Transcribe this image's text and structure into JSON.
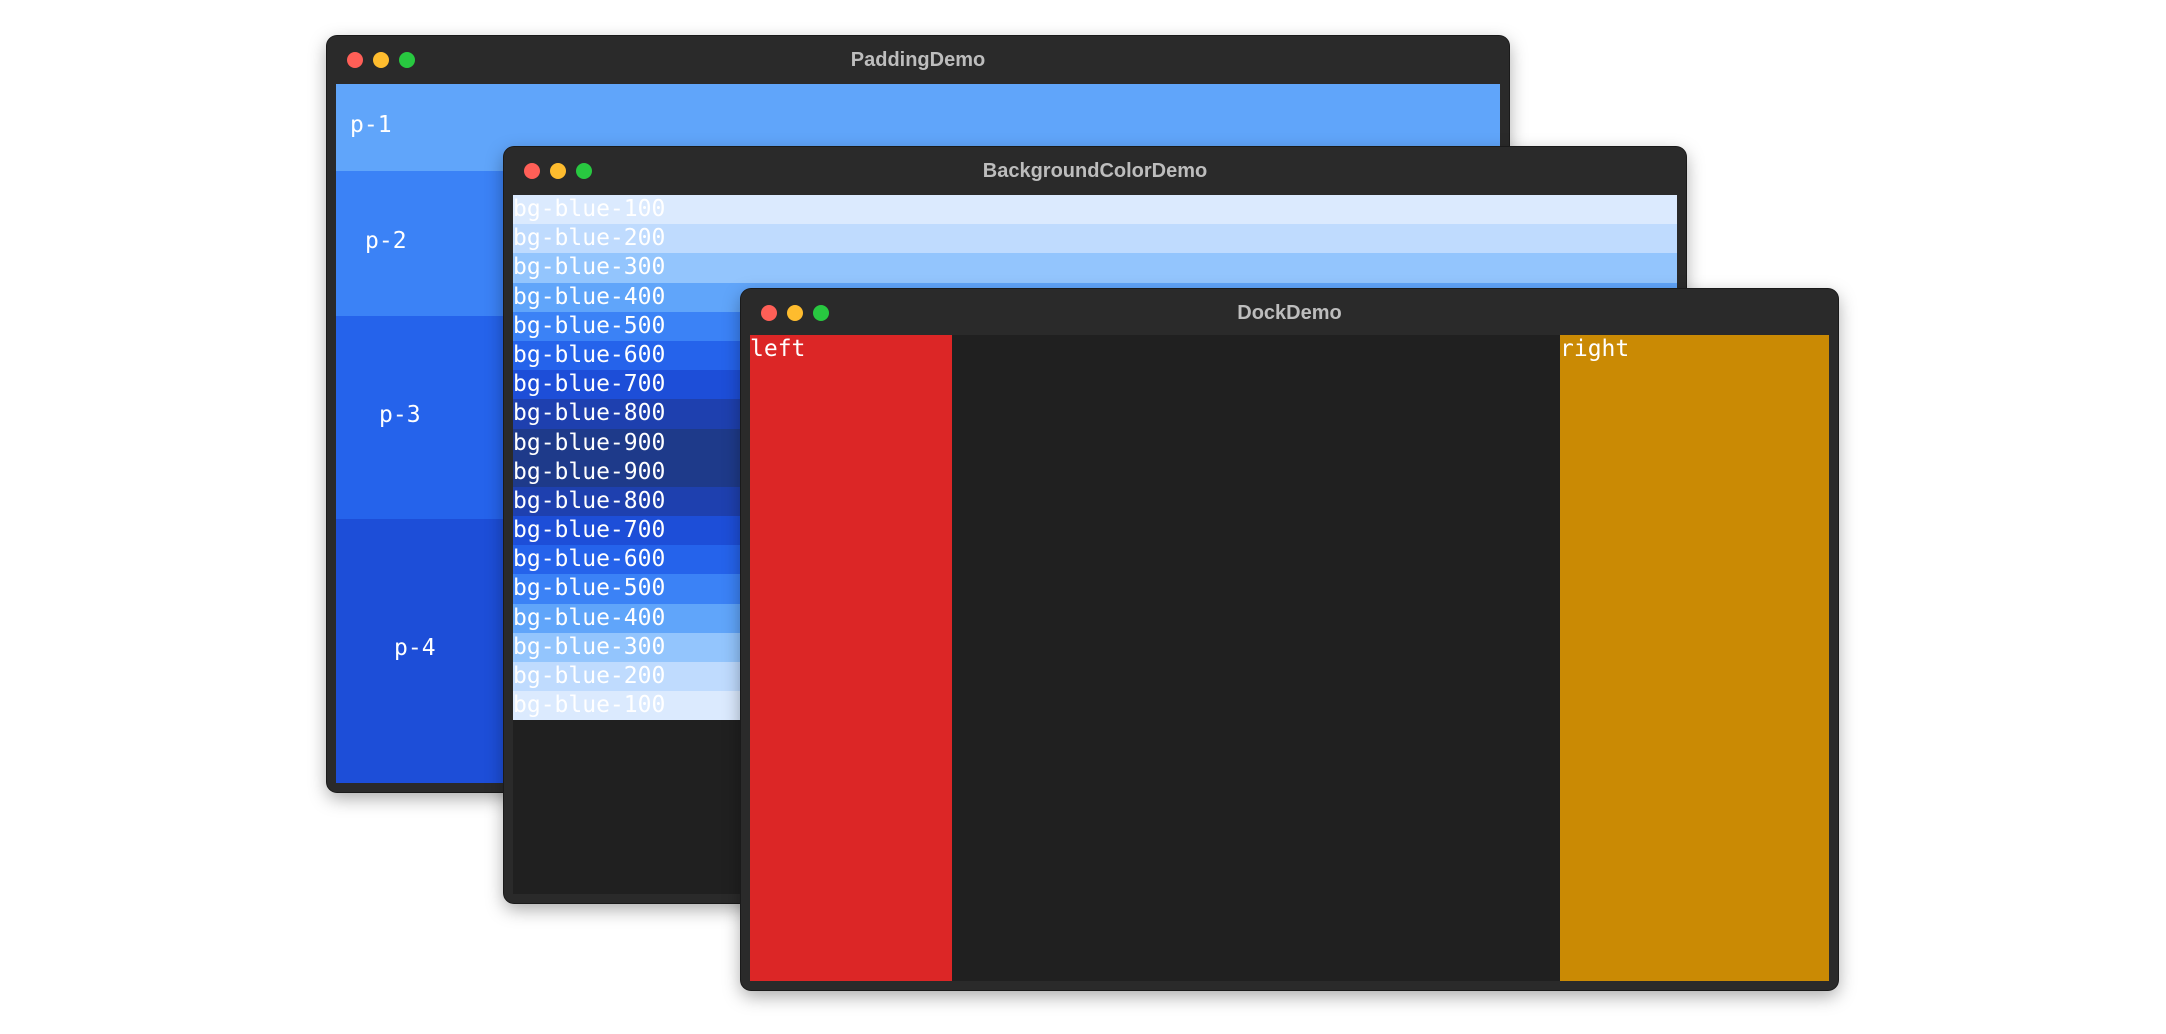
{
  "padding_demo": {
    "title": "PaddingDemo",
    "rows": [
      {
        "label": "p-1",
        "color": "#60a5fa"
      },
      {
        "label": "p-2",
        "color": "#3b82f6"
      },
      {
        "label": "p-3",
        "color": "#2563eb"
      },
      {
        "label": "p-4",
        "color": "#1d4ed8"
      }
    ]
  },
  "background_color_demo": {
    "title": "BackgroundColorDemo",
    "rows": [
      {
        "label": "bg-blue-100",
        "color": "#dbeafe"
      },
      {
        "label": "bg-blue-200",
        "color": "#bfdbfe"
      },
      {
        "label": "bg-blue-300",
        "color": "#93c5fd"
      },
      {
        "label": "bg-blue-400",
        "color": "#60a5fa"
      },
      {
        "label": "bg-blue-500",
        "color": "#3b82f6"
      },
      {
        "label": "bg-blue-600",
        "color": "#2563eb"
      },
      {
        "label": "bg-blue-700",
        "color": "#1d4ed8"
      },
      {
        "label": "bg-blue-800",
        "color": "#1e40af"
      },
      {
        "label": "bg-blue-900",
        "color": "#1e3a8a"
      },
      {
        "label": "bg-blue-900",
        "color": "#1e3a8a"
      },
      {
        "label": "bg-blue-800",
        "color": "#1e40af"
      },
      {
        "label": "bg-blue-700",
        "color": "#1d4ed8"
      },
      {
        "label": "bg-blue-600",
        "color": "#2563eb"
      },
      {
        "label": "bg-blue-500",
        "color": "#3b82f6"
      },
      {
        "label": "bg-blue-400",
        "color": "#60a5fa"
      },
      {
        "label": "bg-blue-300",
        "color": "#93c5fd"
      },
      {
        "label": "bg-blue-200",
        "color": "#bfdbfe"
      },
      {
        "label": "bg-blue-100",
        "color": "#dbeafe"
      }
    ]
  },
  "dock_demo": {
    "title": "DockDemo",
    "left_label": "left",
    "right_label": "right",
    "left_color": "#dc2626",
    "right_color": "#ca8a04"
  }
}
